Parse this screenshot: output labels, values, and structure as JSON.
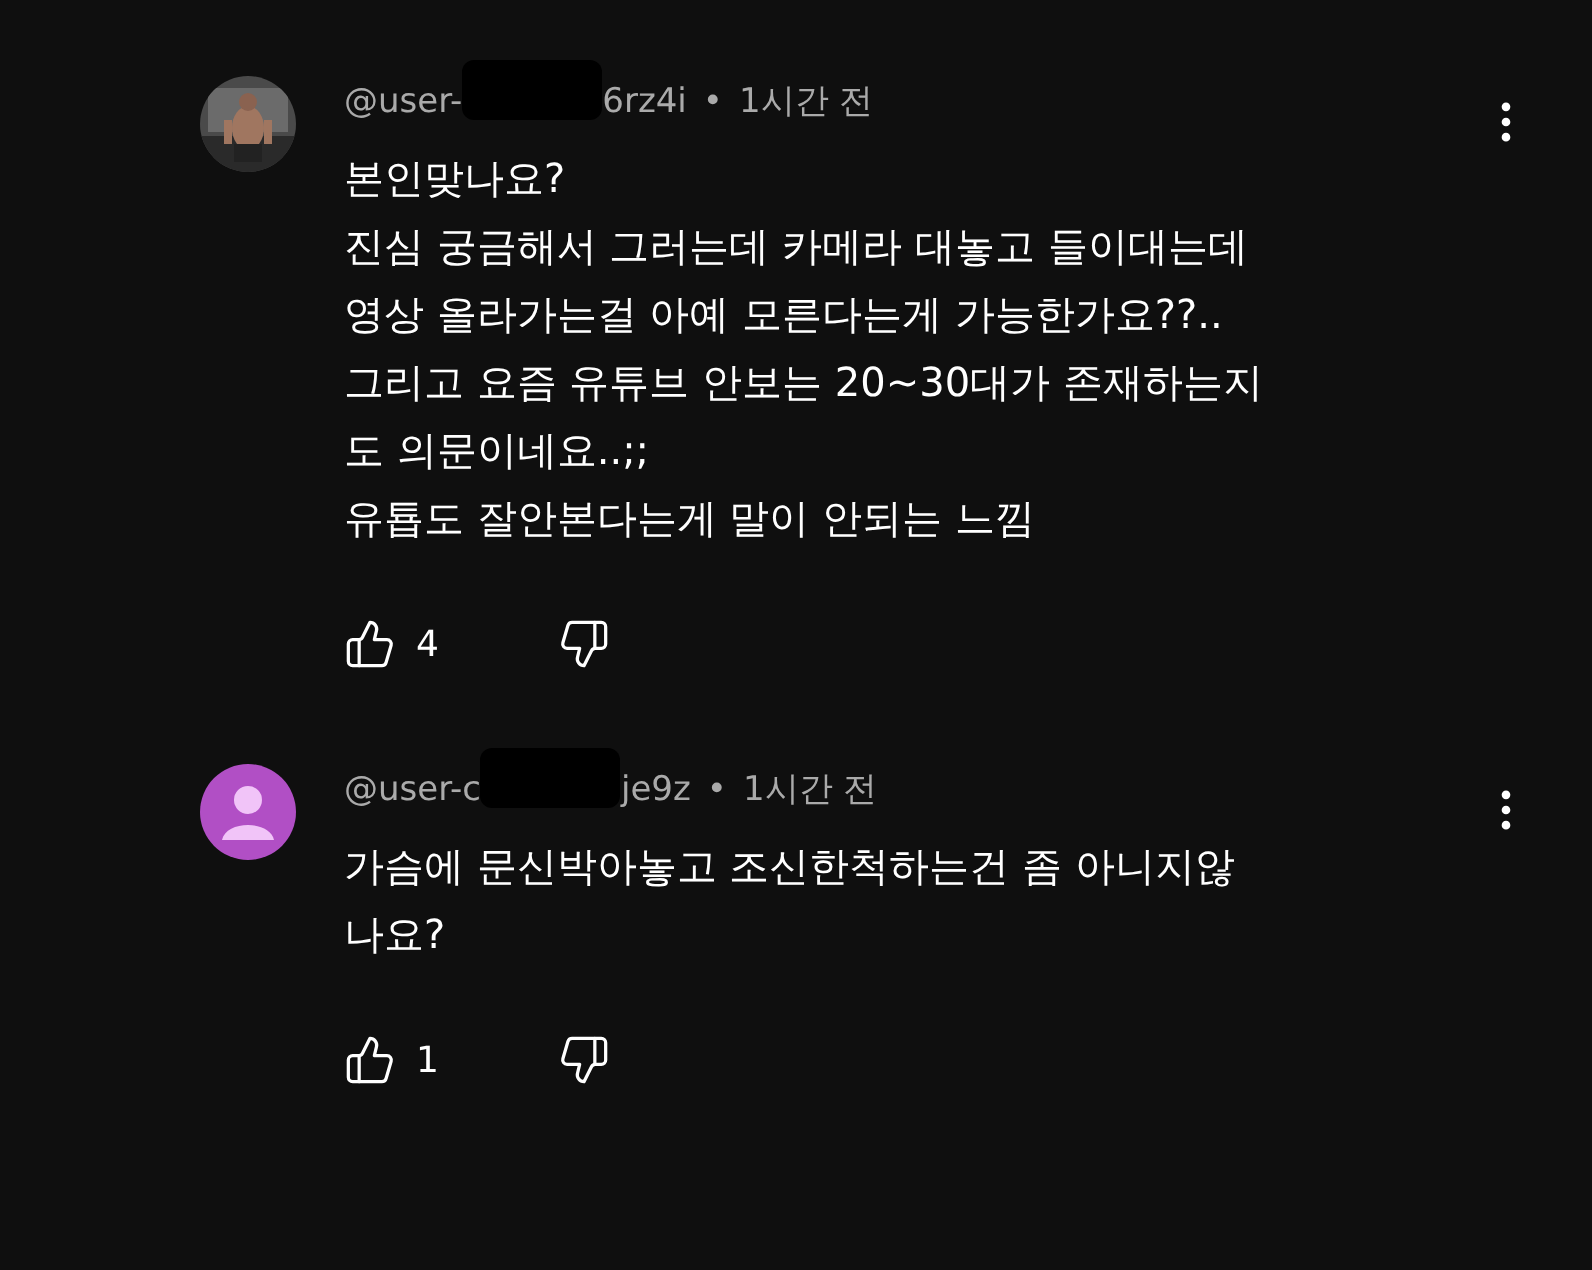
{
  "comments": [
    {
      "username_start": "@user-",
      "username_end": "6rz4i",
      "separator": "•",
      "time": "1시간 전",
      "lines": [
        "본인맞나요?",
        "진심 궁금해서 그러는데 카메라 대놓고 들이대는데",
        "영상 올라가는걸 아예 모른다는게 가능한가요??..",
        "그리고 요즘 유튜브 안보는 20~30대가 존재하는지",
        "도 의문이네요..;;",
        "유툡도 잘안본다는게 말이 안되는 느낌"
      ],
      "likes": "4"
    },
    {
      "avatar": {
        "kind": "default",
        "color": "#b14fc5"
      },
      "username_start": "@user-c",
      "username_end": "je9z",
      "separator": "•",
      "time": "1시간 전",
      "lines": [
        "가슴에 문신박아놓고 조신한척하는건 좀 아니지않",
        "나요?"
      ],
      "likes": "1"
    }
  ]
}
